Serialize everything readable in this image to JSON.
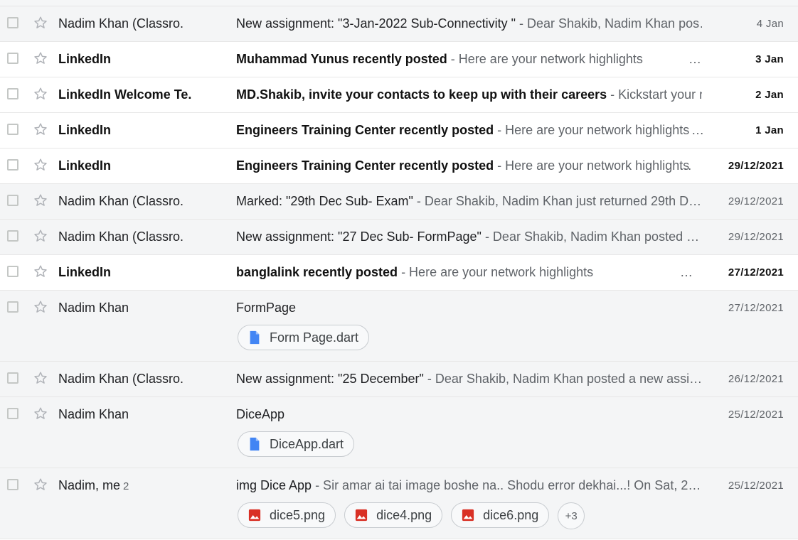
{
  "colors": {
    "doc_icon": "#4285f4",
    "image_icon": "#d93025"
  },
  "rows": [
    {
      "sender": "Nadim Khan (Classro.",
      "subject": "New assignment: \"3-Jan-2022 Sub-Connectivity \"",
      "snippet": " - Dear Shakib, Nadim Khan pos…",
      "date": "4 Jan"
    },
    {
      "sender": "LinkedIn",
      "subject": "Muhammad Yunus recently posted",
      "snippet": " - Here are your network highlights",
      "ellipsis": "…",
      "date": "3 Jan"
    },
    {
      "sender": "LinkedIn Welcome Te.",
      "subject": "MD.Shakib, invite your contacts to keep up with their careers",
      "snippet": " - Kickstart your ne…",
      "date": "2 Jan"
    },
    {
      "sender": "LinkedIn",
      "subject": "Engineers Training Center recently posted",
      "snippet": " - Here are your network highlights",
      "ellipsis": "…",
      "date": "1 Jan"
    },
    {
      "sender": "LinkedIn",
      "subject": "Engineers Training Center recently posted",
      "snippet": " - Here are your network highlights",
      "ellipsis": "…",
      "date": "29/12/2021"
    },
    {
      "sender": "Nadim Khan (Classro.",
      "subject": "Marked: \"29th Dec Sub- Exam\"",
      "snippet": " - Dear Shakib, Nadim Khan just returned 29th D…",
      "date": "29/12/2021"
    },
    {
      "sender": "Nadim Khan (Classro.",
      "subject": "New assignment: \"27 Dec Sub- FormPage\"",
      "snippet": " - Dear Shakib, Nadim Khan posted …",
      "date": "29/12/2021"
    },
    {
      "sender": "LinkedIn",
      "subject": "banglalink recently posted",
      "snippet": " - Here are your network highlights",
      "ellipsis": "…",
      "date": "27/12/2021"
    },
    {
      "sender": "Nadim Khan",
      "subject": "FormPage",
      "snippet": "",
      "date": "27/12/2021",
      "attachments": [
        "Form Page.dart"
      ]
    },
    {
      "sender": "Nadim Khan (Classro.",
      "subject": "New assignment: \"25 December\"",
      "snippet": " - Dear Shakib, Nadim Khan posted a new assi…",
      "date": "26/12/2021"
    },
    {
      "sender": "Nadim Khan",
      "subject": "DiceApp",
      "snippet": "",
      "date": "25/12/2021",
      "attachments": [
        "DiceApp.dart"
      ]
    },
    {
      "sender": "Nadim, me",
      "count": "2",
      "subject": "img Dice App",
      "snippet": " - Sir amar ai tai image boshe na.. Shodu error dekhai...! On Sat, 2…",
      "date": "25/12/2021",
      "attachments": [
        "dice5.png",
        "dice4.png",
        "dice6.png"
      ],
      "more": "+3"
    }
  ]
}
